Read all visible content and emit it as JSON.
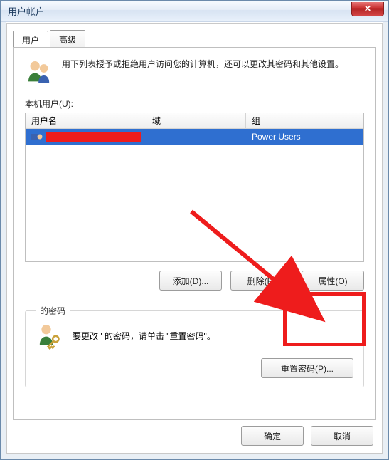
{
  "title": "用户帐户",
  "tabs": {
    "users": "用户",
    "advanced": "高级"
  },
  "intro": "用下列表授予或拒绝用户访问您的计算机，还可以更改其密码和其他设置。",
  "list_label": "本机用户(U):",
  "columns": {
    "name": "用户名",
    "domain": "域",
    "group": "组"
  },
  "rows": [
    {
      "name": "",
      "domain": "",
      "group": "Power Users"
    }
  ],
  "buttons": {
    "add": "添加(D)...",
    "remove": "删除(R)",
    "properties": "属性(O)",
    "reset_pw": "重置密码(P)...",
    "ok": "确定",
    "cancel": "取消"
  },
  "pw_group": {
    "legend": "的密码",
    "text": "要更改 '   的密码，请单击 \"重置密码\"。"
  }
}
